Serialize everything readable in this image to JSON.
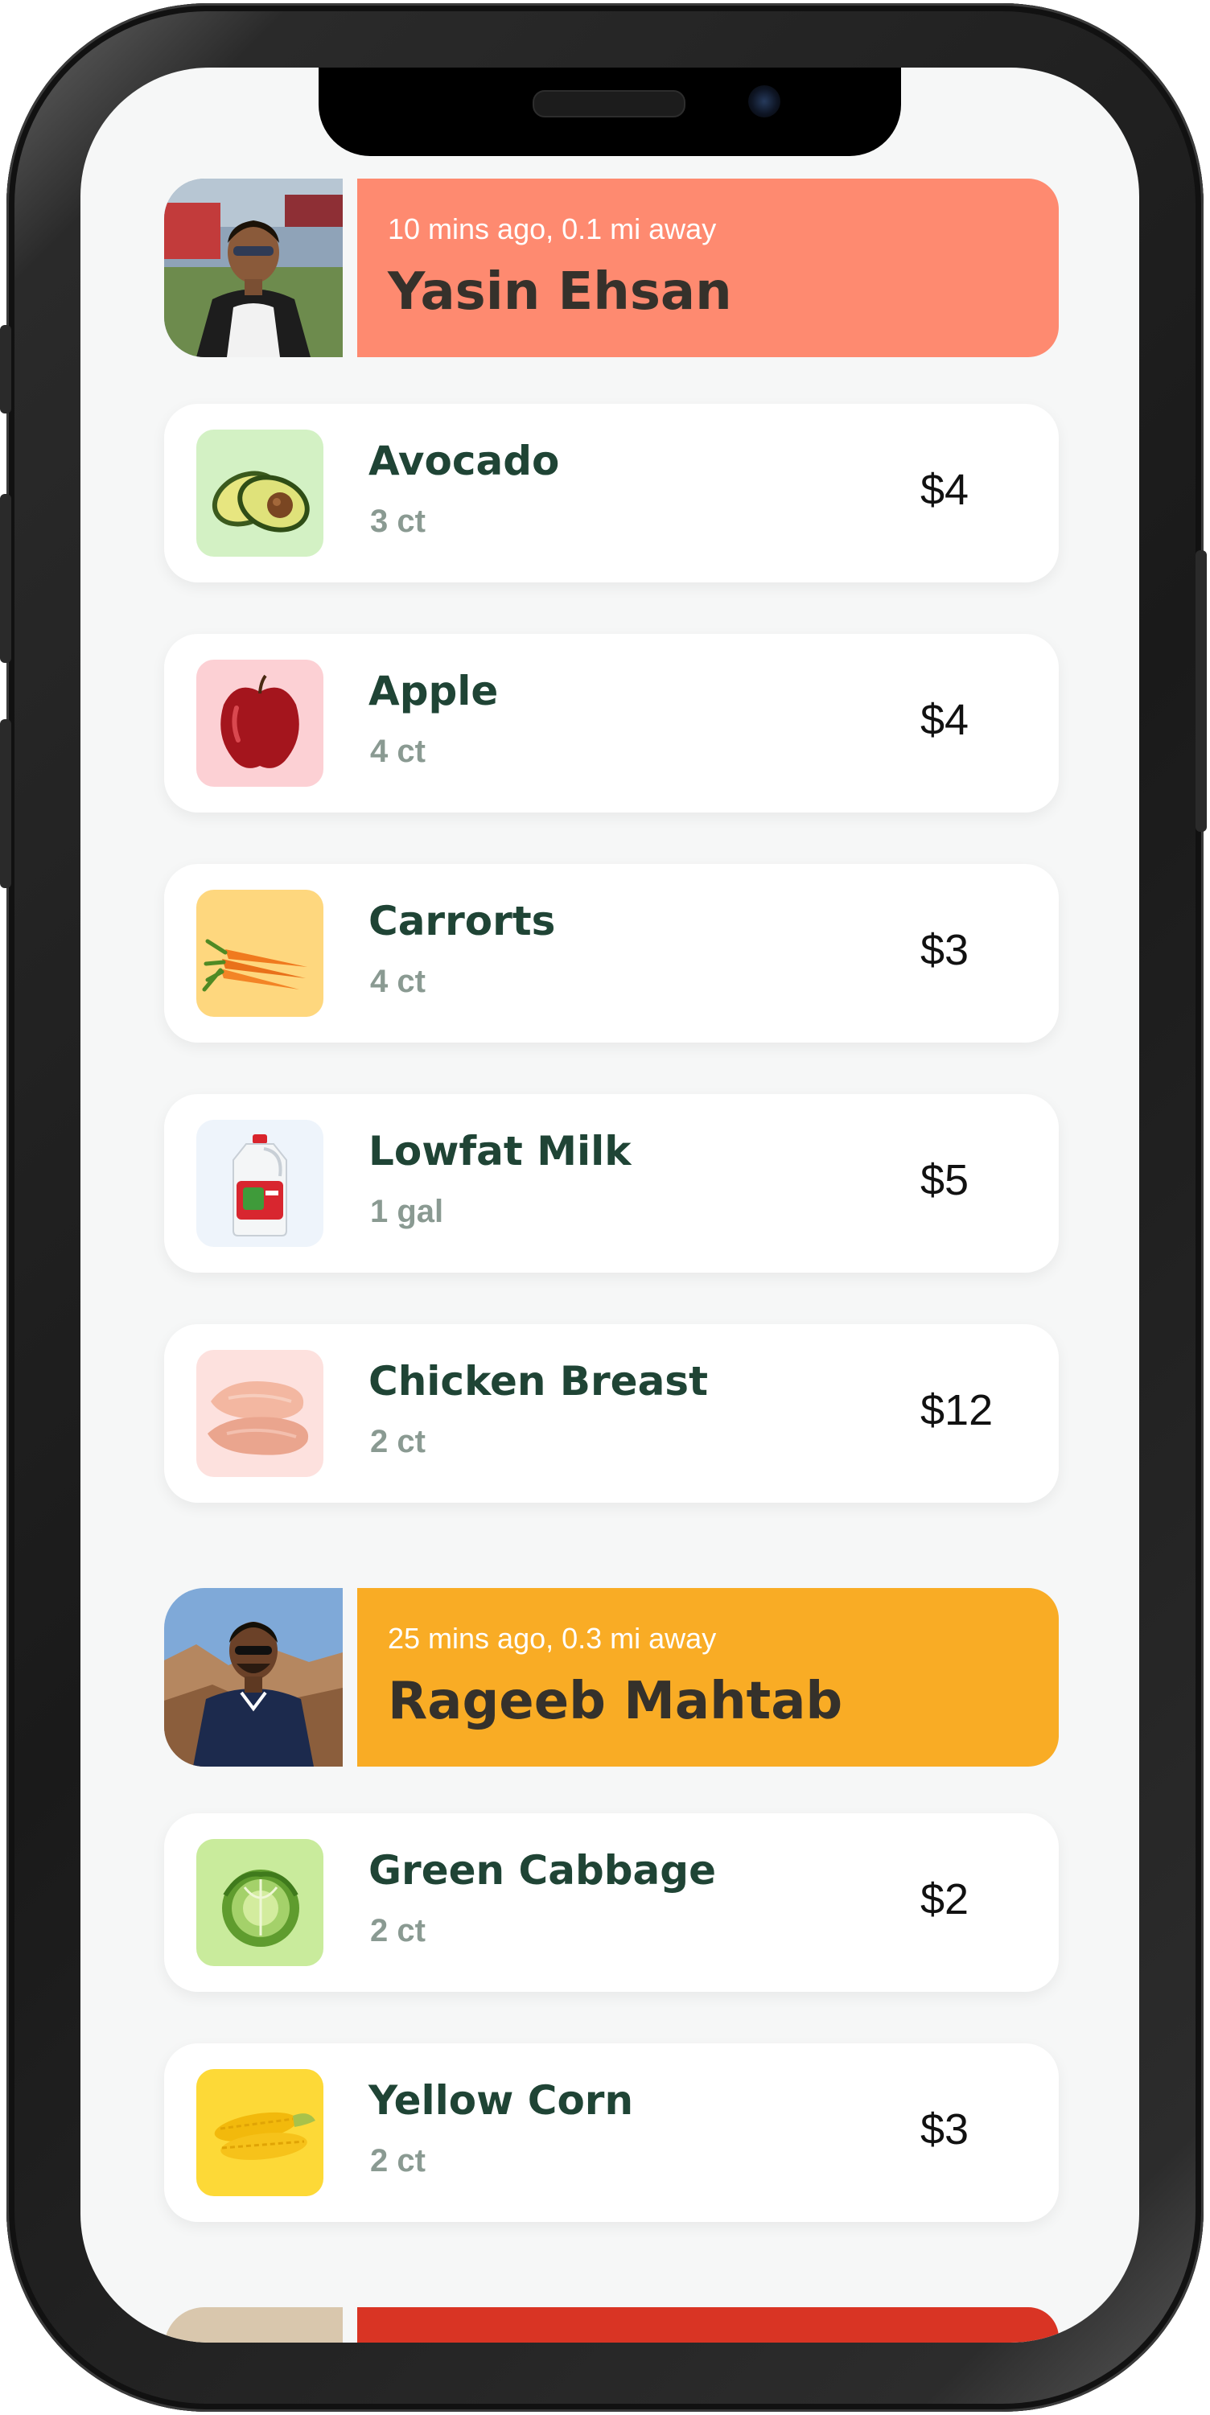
{
  "users": [
    {
      "meta": "10 mins ago, 0.1 mi away",
      "name": "Yasin Ehsan",
      "color": "#fe8a70",
      "items": [
        {
          "name": "Avocado",
          "qty": "3 ct",
          "price": "$4",
          "icon": "avocado-icon",
          "bg": "#d3f1c4"
        },
        {
          "name": "Apple",
          "qty": "4 ct",
          "price": "$4",
          "icon": "apple-icon",
          "bg": "#fcd0d4"
        },
        {
          "name": "Carrorts",
          "qty": "4 ct",
          "price": "$3",
          "icon": "carrot-icon",
          "bg": "#fed77e"
        },
        {
          "name": "Lowfat Milk",
          "qty": "1 gal",
          "price": "$5",
          "icon": "milk-icon",
          "bg": "#eef4fb"
        },
        {
          "name": "Chicken Breast",
          "qty": "2 ct",
          "price": "$12",
          "icon": "chicken-breast-icon",
          "bg": "#fde1de"
        }
      ]
    },
    {
      "meta": "25 mins ago, 0.3 mi away",
      "name": "Rageeb Mahtab",
      "color": "#f9ac25",
      "items": [
        {
          "name": "Green Cabbage",
          "qty": "2 ct",
          "price": "$2",
          "icon": "cabbage-icon",
          "bg": "#c9eb9c"
        },
        {
          "name": "Yellow Corn",
          "qty": "2 ct",
          "price": "$3",
          "icon": "corn-icon",
          "bg": "#fdd937"
        }
      ]
    },
    {
      "color": "#d93424"
    }
  ]
}
